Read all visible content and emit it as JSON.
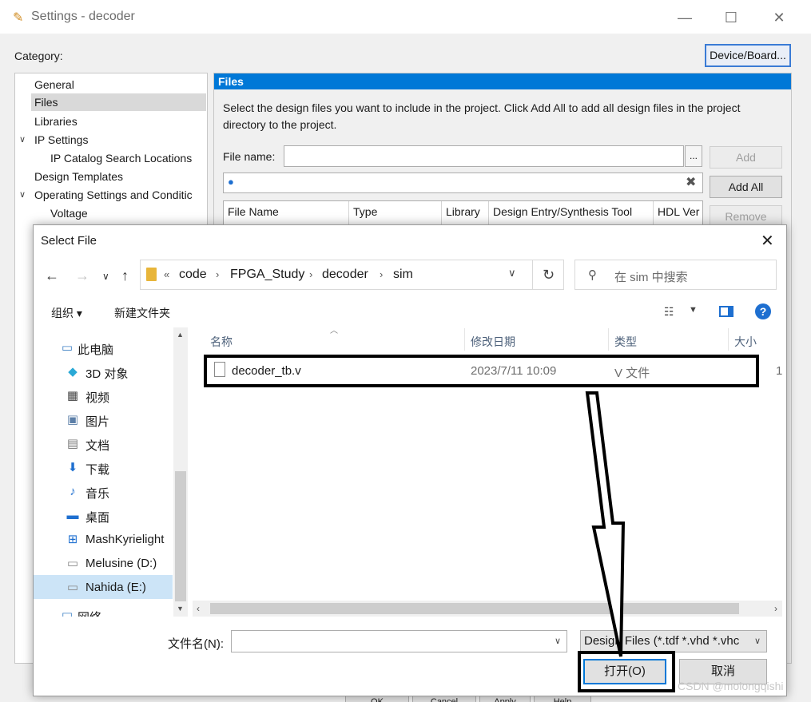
{
  "settings": {
    "title": "Settings - decoder",
    "category_label": "Category:",
    "device_board_label": "Device/Board...",
    "categories": [
      {
        "label": "General"
      },
      {
        "label": "Files"
      },
      {
        "label": "Libraries"
      },
      {
        "label": "IP Settings"
      },
      {
        "label": "IP Catalog Search Locations"
      },
      {
        "label": "Design Templates"
      },
      {
        "label": "Operating Settings and Conditic"
      },
      {
        "label": "Voltage"
      }
    ],
    "files_header": "Files",
    "files_description": "Select the design files you want to include in the project. Click Add All to add all design files in the project directory to the project.",
    "file_name_label": "File name:",
    "file_name_value": "",
    "browse_label": "...",
    "buttons": {
      "add": "Add",
      "add_all": "Add All",
      "remove": "Remove"
    },
    "table_columns": [
      "File Name",
      "Type",
      "Library",
      "Design Entry/Synthesis Tool",
      "HDL Ver"
    ],
    "bottom_buttons": [
      "OK",
      "Cancel",
      "Apply",
      "Help"
    ]
  },
  "dialog": {
    "title": "Select File",
    "breadcrumb": [
      "code",
      "FPGA_Study",
      "decoder",
      "sim"
    ],
    "breadcrumb_overflow": "«",
    "search_placeholder": "在 sim 中搜索",
    "toolbar": {
      "organize": "组织 ▾",
      "new_folder": "新建文件夹"
    },
    "nav_items": [
      {
        "label": "此电脑",
        "icon": "computer-icon"
      },
      {
        "label": "3D 对象",
        "icon": "3d-objects-icon"
      },
      {
        "label": "视频",
        "icon": "videos-icon"
      },
      {
        "label": "图片",
        "icon": "pictures-icon"
      },
      {
        "label": "文档",
        "icon": "documents-icon"
      },
      {
        "label": "下载",
        "icon": "downloads-icon"
      },
      {
        "label": "音乐",
        "icon": "music-icon"
      },
      {
        "label": "桌面",
        "icon": "desktop-icon"
      },
      {
        "label": "MashKyrielight",
        "icon": "drive-c-icon"
      },
      {
        "label": "Melusine (D:)",
        "icon": "drive-d-icon"
      },
      {
        "label": "Nahida (E:)",
        "icon": "drive-e-icon"
      },
      {
        "label": "网络",
        "icon": "network-icon"
      }
    ],
    "columns": [
      "名称",
      "修改日期",
      "类型",
      "大小"
    ],
    "files": [
      {
        "name": "decoder_tb.v",
        "modified": "2023/7/11 10:09",
        "type": "V 文件",
        "size": "1"
      }
    ],
    "filename_label": "文件名(N):",
    "filename_value": "",
    "filetype_value": "Design Files (*.tdf *.vhd *.vhc",
    "open_label": "打开(O)",
    "cancel_label": "取消"
  },
  "watermark": "CSDN @molongqishi",
  "colors": {
    "accent": "#0078d7",
    "selected_nav": "#cce4f7",
    "annotation": "#000000"
  }
}
